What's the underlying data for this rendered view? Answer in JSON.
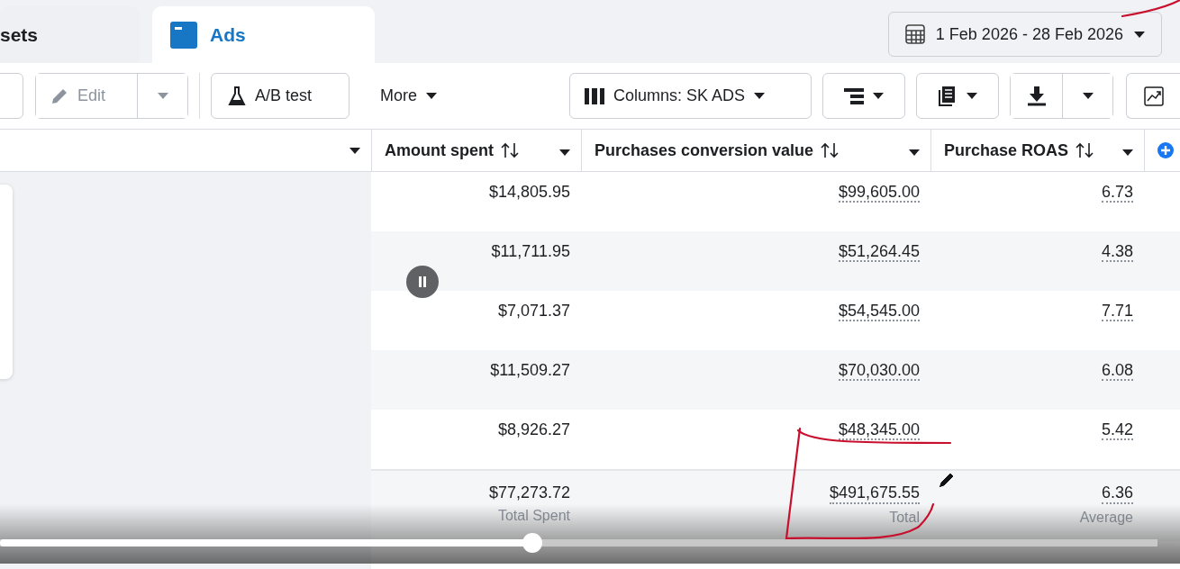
{
  "tabs": [
    {
      "label": "sets",
      "selected": false
    },
    {
      "label": "Ads",
      "selected": true
    }
  ],
  "date_range": {
    "label": "1 Feb 2026 - 28 Feb 2026"
  },
  "toolbar": {
    "edit": {
      "label": "Edit",
      "disabled": true
    },
    "ab_test": {
      "label": "A/B test"
    },
    "more": {
      "label": "More"
    },
    "columns": {
      "label": "Columns: SK ADS"
    }
  },
  "table": {
    "columns": [
      {
        "label": "Amount spent"
      },
      {
        "label": "Purchases conversion value"
      },
      {
        "label": "Purchase ROAS"
      }
    ],
    "rows": [
      [
        "$14,805.95",
        "$99,605.00",
        "6.73"
      ],
      [
        "$11,711.95",
        "$51,264.45",
        "4.38"
      ],
      [
        "$7,071.37",
        "$54,545.00",
        "7.71"
      ],
      [
        "$11,509.27",
        "$70,030.00",
        "6.08"
      ],
      [
        "$8,926.27",
        "$48,345.00",
        "5.42"
      ]
    ],
    "totals": [
      {
        "value": "$77,273.72",
        "label": "Total Spent"
      },
      {
        "value": "$491,675.55",
        "label": "Total"
      },
      {
        "value": "6.36",
        "label": "Average"
      }
    ]
  },
  "video_player": {
    "playing": true,
    "level": 0.46
  }
}
